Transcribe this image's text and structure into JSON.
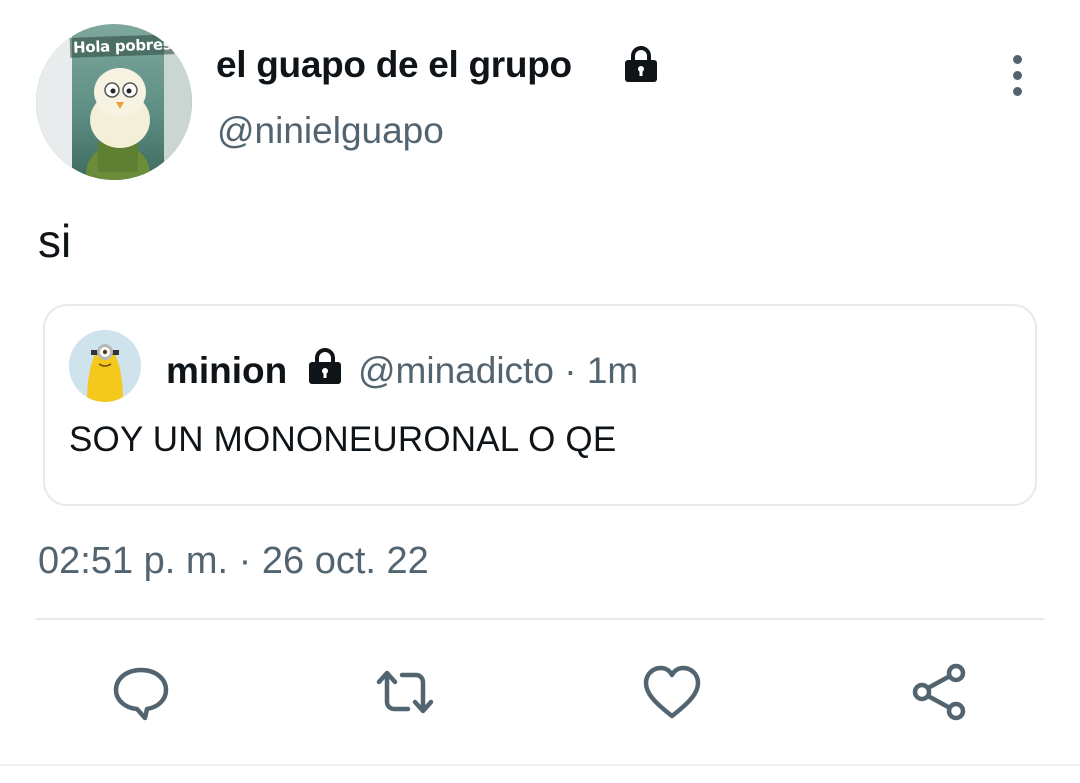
{
  "tweet": {
    "author": {
      "display_name": "el guapo de el grupo",
      "username": "@ninielguapo",
      "avatar_caption": "Hola pobres",
      "protected": true
    },
    "text": "si",
    "quoted_tweet": {
      "display_name": "minion",
      "username": "@minadicto",
      "separator": "·",
      "age": "1m",
      "protected": true,
      "text": "SOY UN MONONEURONAL O QE"
    },
    "timestamp": "02:51 p. m. · 26 oct. 22"
  },
  "actions": [
    {
      "name": "reply",
      "icon": "speech-bubble-icon"
    },
    {
      "name": "retweet",
      "icon": "retweet-icon"
    },
    {
      "name": "like",
      "icon": "heart-icon"
    },
    {
      "name": "share",
      "icon": "share-icon"
    }
  ],
  "colors": {
    "text_primary": "#0f1419",
    "text_secondary": "#536471",
    "border": "#e6eaed",
    "icon": "#536471"
  }
}
